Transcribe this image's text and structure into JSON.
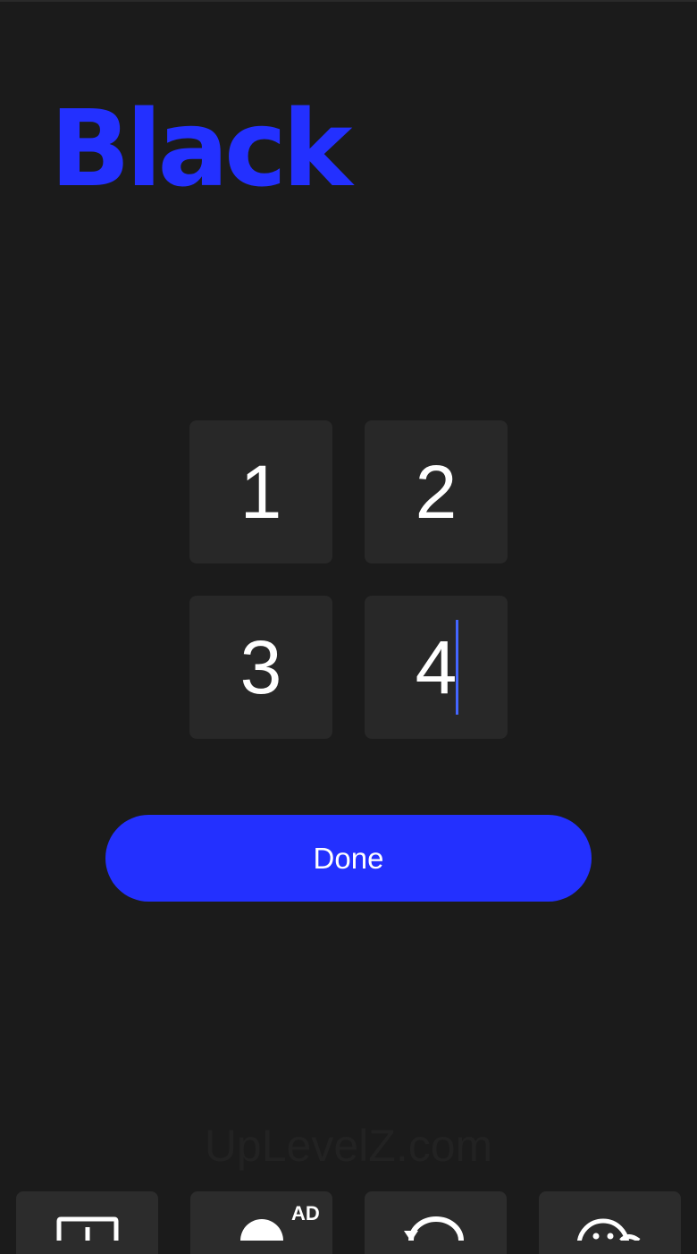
{
  "header": {
    "title": "Black",
    "title_color": "#2330ff"
  },
  "grid": {
    "cells": [
      "1",
      "2",
      "3",
      "4"
    ],
    "active_cell_index": 3
  },
  "actions": {
    "done_label": "Done",
    "done_color": "#2330ff"
  },
  "watermark": {
    "text": "UpLevelZ.com"
  },
  "toolbar": {
    "items": [
      {
        "icon": "square-plus-icon"
      },
      {
        "icon": "person-icon",
        "badge": "AD"
      },
      {
        "icon": "undo-icon"
      },
      {
        "icon": "emoji-icon"
      }
    ]
  }
}
